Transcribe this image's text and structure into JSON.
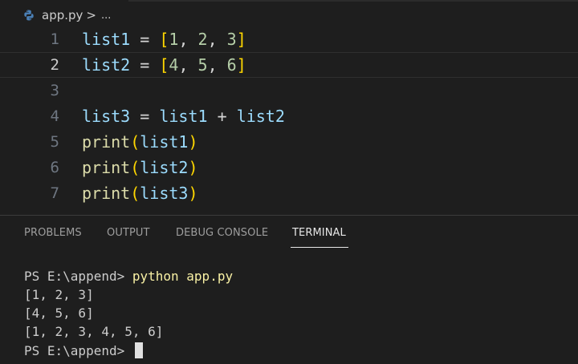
{
  "editor": {
    "breadcrumb": {
      "file": "app.py",
      "separator": ">",
      "ellipsis": "..."
    },
    "current_line": 2,
    "lines": [
      {
        "number": "1",
        "tokens": {
          "a": "list1",
          "b": " = ",
          "c": "[",
          "d": "1",
          "e": ", ",
          "f": "2",
          "g": ", ",
          "h": "3",
          "i": "]"
        }
      },
      {
        "number": "2",
        "tokens": {
          "a": "list2",
          "b": " = ",
          "c": "[",
          "d": "4",
          "e": ", ",
          "f": "5",
          "g": ", ",
          "h": "6",
          "i": "]"
        }
      },
      {
        "number": "3"
      },
      {
        "number": "4",
        "tokens": {
          "a": "list3",
          "b": " = ",
          "c": "list1",
          "d": " + ",
          "e": "list2"
        }
      },
      {
        "number": "5",
        "tokens": {
          "fn": "print",
          "open": "(",
          "arg": "list1",
          "close": ")"
        }
      },
      {
        "number": "6",
        "tokens": {
          "fn": "print",
          "open": "(",
          "arg": "list2",
          "close": ")"
        }
      },
      {
        "number": "7",
        "tokens": {
          "fn": "print",
          "open": "(",
          "arg": "list3",
          "close": ")"
        }
      }
    ]
  },
  "panel": {
    "tabs": [
      {
        "label": "PROBLEMS"
      },
      {
        "label": "OUTPUT"
      },
      {
        "label": "DEBUG CONSOLE"
      },
      {
        "label": "TERMINAL",
        "active": true
      }
    ]
  },
  "terminal": {
    "prompt": "PS E:\\append> ",
    "command": "python app.py",
    "output": [
      "[1, 2, 3]",
      "[4, 5, 6]",
      "[1, 2, 3, 4, 5, 6]"
    ],
    "prompt2": "PS E:\\append> "
  },
  "colors": {
    "background": "#1e1e1e",
    "variable": "#9cdcfe",
    "function": "#dcdcaa",
    "bracket": "#ffd700",
    "number": "#b5cea8",
    "terminal_command": "#f9f1a5"
  },
  "icons": {
    "file_icon": "python-icon",
    "terminal_cursor": "cursor-block"
  }
}
